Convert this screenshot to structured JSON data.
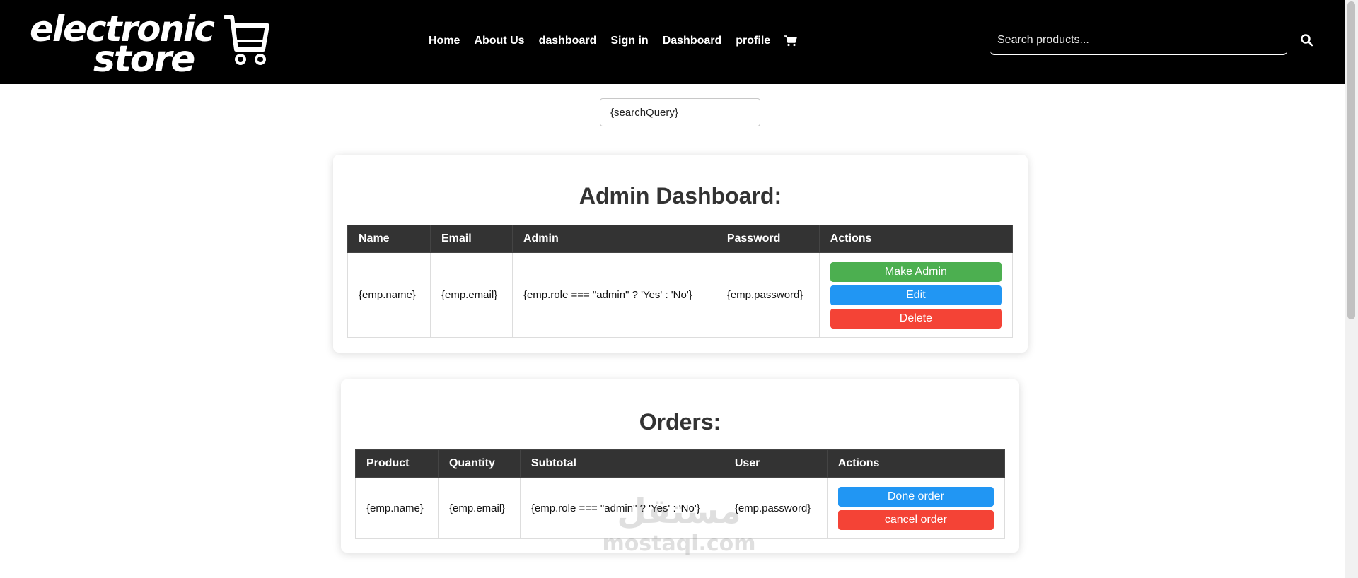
{
  "header": {
    "logo_line1": "electronic",
    "logo_line2": "store",
    "nav": [
      "Home",
      "About Us",
      "dashboard",
      "Sign in",
      "Dashboard",
      "profile"
    ],
    "search_placeholder": "Search products...",
    "background_color": "#000000"
  },
  "query_box": {
    "value": "{searchQuery}"
  },
  "admin": {
    "title": "Admin Dashboard:",
    "columns": [
      "Name",
      "Email",
      "Admin",
      "Password",
      "Actions"
    ],
    "row": {
      "name": "{emp.name}",
      "email": "{emp.email}",
      "admin": "{emp.role === \"admin\" ? 'Yes' : 'No'}",
      "password": "{emp.password}"
    },
    "actions": [
      "Make Admin",
      "Edit",
      "Delete"
    ]
  },
  "orders": {
    "title": "Orders:",
    "columns": [
      "Product",
      "Quantity",
      "Subtotal",
      "User",
      "Actions"
    ],
    "row": {
      "product": "{emp.name}",
      "quantity": "{emp.email}",
      "subtotal": "{emp.role === \"admin\" ? 'Yes' : 'No'}",
      "user": "{emp.password}"
    },
    "actions": [
      "Done order",
      "cancel order"
    ]
  },
  "watermark": {
    "arabic": "مستقل",
    "latin": "mostaql.com"
  },
  "colors": {
    "green": "#4caf50",
    "blue": "#2196f3",
    "red": "#f44336",
    "table_header": "#333333"
  },
  "icons": {
    "nav_cart": "shopping-cart-icon",
    "search": "search-icon",
    "logo_cart": "logo-cart-icon"
  }
}
